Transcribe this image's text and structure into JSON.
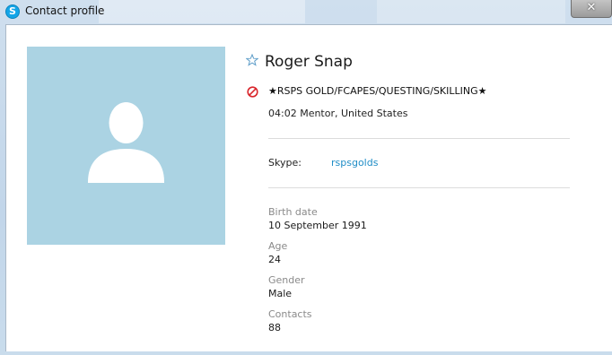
{
  "window": {
    "title": "Contact profile",
    "close_label": "✕",
    "app_icon_glyph": "S"
  },
  "icons": {
    "app": "skype-icon",
    "favorite": "star-outline-icon",
    "status": "do-not-disturb-icon",
    "avatar": "default-user-avatar-icon",
    "close": "close-icon"
  },
  "colors": {
    "avatar_background": "#abd3e3",
    "link": "#1f8dc6",
    "status_dnd": "#d9262c",
    "skype_brand": "#12a5e8"
  },
  "profile": {
    "name": "Roger Snap",
    "mood_message": "★RSPS GOLD/FCAPES/QUESTING/SKILLING★",
    "local_time_location": "04:02 Mentor, United States",
    "skype_label": "Skype:",
    "skype_name": "rspsgolds",
    "fields": [
      {
        "label": "Birth date",
        "value": "10 September 1991"
      },
      {
        "label": "Age",
        "value": "24"
      },
      {
        "label": "Gender",
        "value": "Male"
      },
      {
        "label": "Contacts",
        "value": "88"
      }
    ]
  }
}
